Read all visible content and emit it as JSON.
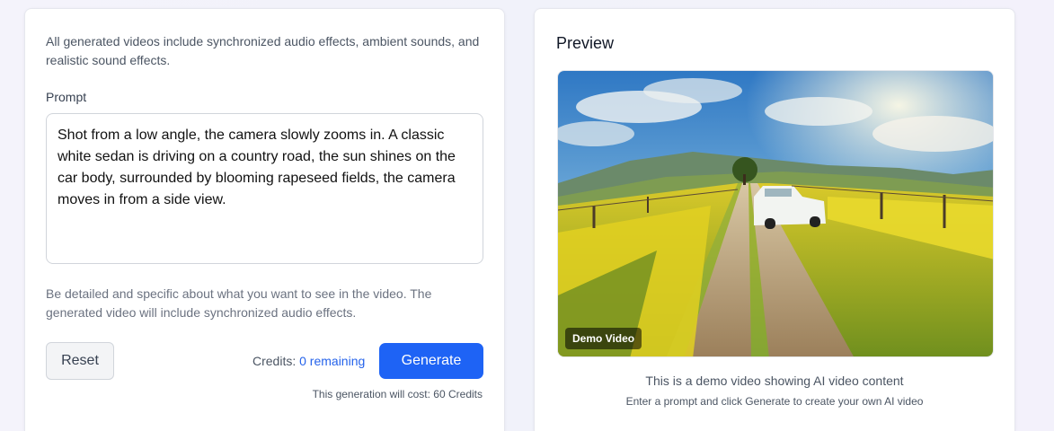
{
  "generator": {
    "info_text": "All generated videos include synchronized audio effects, ambient sounds, and realistic sound effects.",
    "prompt_label": "Prompt",
    "prompt_value": "Shot from a low angle, the camera slowly zooms in. A classic white sedan is driving on a country road, the sun shines on the car body, surrounded by blooming rapeseed fields, the camera moves in from a side view.",
    "hint_text": "Be detailed and specific about what you want to see in the video. The generated video will include synchronized audio effects.",
    "reset_label": "Reset",
    "credits_label": "Credits:",
    "credits_remaining": "0 remaining",
    "generate_label": "Generate",
    "cost_text": "This generation will cost: 60 Credits"
  },
  "preview": {
    "title": "Preview",
    "badge": "Demo Video",
    "caption": "This is a demo video showing AI video content",
    "subcaption": "Enter a prompt and click Generate to create your own AI video"
  },
  "colors": {
    "accent": "#1e63f5",
    "link": "#2563eb"
  }
}
